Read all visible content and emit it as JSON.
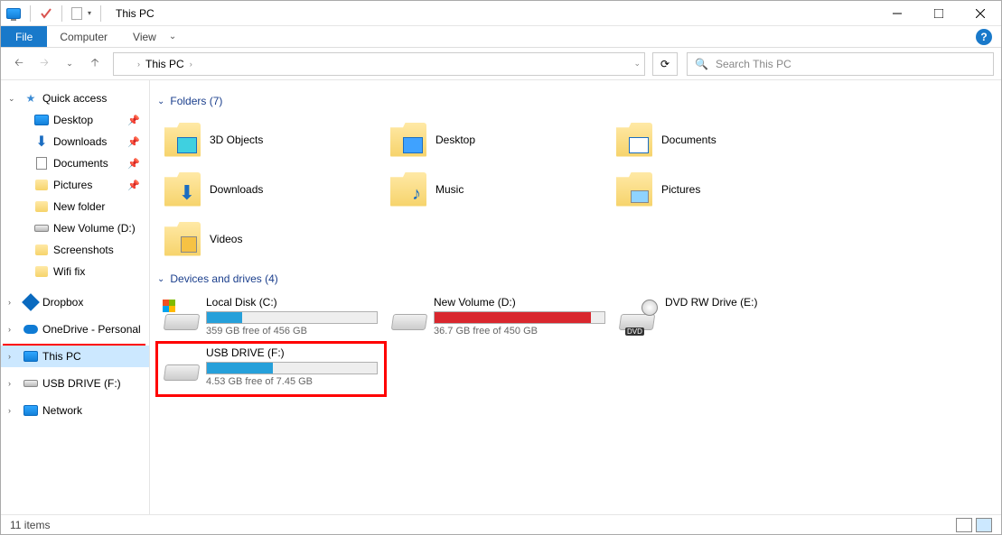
{
  "window": {
    "title": "This PC"
  },
  "ribbon": {
    "file": "File",
    "tabs": [
      "Computer",
      "View"
    ]
  },
  "breadcrumb": {
    "location": "This PC"
  },
  "search": {
    "placeholder": "Search This PC"
  },
  "sidebar": {
    "quick_access": {
      "label": "Quick access",
      "items": [
        {
          "label": "Desktop",
          "pinned": true,
          "kind": "monitor"
        },
        {
          "label": "Downloads",
          "pinned": true,
          "kind": "download"
        },
        {
          "label": "Documents",
          "pinned": true,
          "kind": "doc"
        },
        {
          "label": "Pictures",
          "pinned": true,
          "kind": "pic"
        },
        {
          "label": "New folder",
          "pinned": false,
          "kind": "folder"
        },
        {
          "label": "New Volume (D:)",
          "pinned": false,
          "kind": "drive"
        },
        {
          "label": "Screenshots",
          "pinned": false,
          "kind": "folder"
        },
        {
          "label": "Wifi fix",
          "pinned": false,
          "kind": "folder"
        }
      ]
    },
    "dropbox": "Dropbox",
    "onedrive": "OneDrive - Personal",
    "this_pc": "This PC",
    "usb": "USB DRIVE (F:)",
    "network": "Network"
  },
  "groups": {
    "folders": {
      "header": "Folders (7)",
      "items": [
        "3D Objects",
        "Desktop",
        "Documents",
        "Downloads",
        "Music",
        "Pictures",
        "Videos"
      ]
    },
    "drives": {
      "header": "Devices and drives (4)",
      "items": [
        {
          "name": "Local Disk (C:)",
          "free": "359 GB free of 456 GB",
          "fill": 21,
          "color": "#26a0da",
          "kind": "hdd"
        },
        {
          "name": "New Volume (D:)",
          "free": "36.7 GB free of 450 GB",
          "fill": 92,
          "color": "#d9272e",
          "kind": "hdd"
        },
        {
          "name": "DVD RW Drive (E:)",
          "free": "",
          "fill": 0,
          "color": "",
          "kind": "dvd"
        },
        {
          "name": "USB DRIVE (F:)",
          "free": "4.53 GB free of 7.45 GB",
          "fill": 39,
          "color": "#26a0da",
          "kind": "usb",
          "highlighted": true
        }
      ]
    }
  },
  "status": {
    "text": "11 items"
  }
}
